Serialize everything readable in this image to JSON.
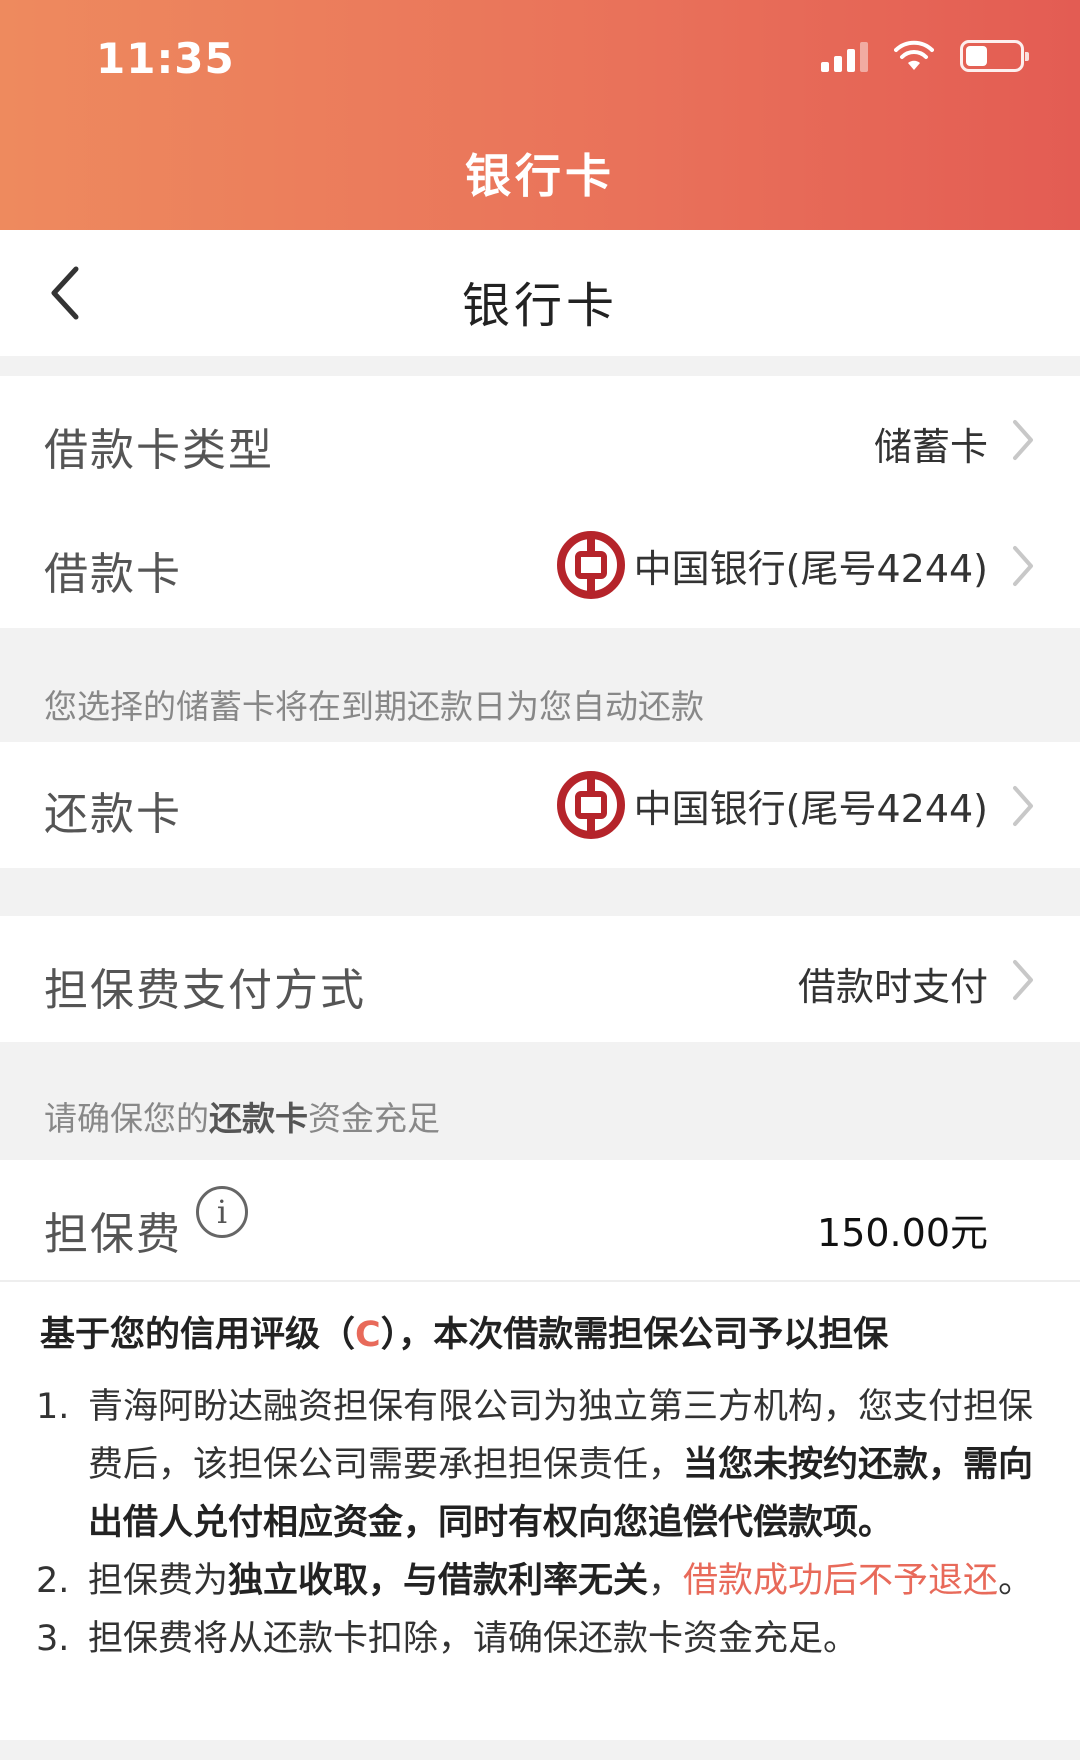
{
  "status_bar": {
    "time": "11:35"
  },
  "header": {
    "title": "银行卡"
  },
  "nav": {
    "title": "银行卡"
  },
  "rows": {
    "card_type": {
      "label": "借款卡类型",
      "value": "储蓄卡"
    },
    "loan_card": {
      "label": "借款卡",
      "value": "中国银行(尾号4244)"
    },
    "repay_card": {
      "label": "还款卡",
      "value": "中国银行(尾号4244)"
    },
    "fee_method": {
      "label": "担保费支付方式",
      "value": "借款时支付"
    },
    "fee": {
      "label": "担保费",
      "value": "150.00元"
    }
  },
  "notes": {
    "auto_repay": "您选择的储蓄卡将在到期还款日为您自动还款",
    "ensure_prefix": "请确保您的",
    "ensure_bold": "还款卡",
    "ensure_suffix": "资金充足"
  },
  "description": {
    "title_prefix": "基于您的信用评级（",
    "grade": "C",
    "title_suffix": "），本次借款需担保公司予以担保",
    "items": [
      {
        "num": "1.",
        "text": "青海阿盼达融资担保有限公司为独立第三方机构，您支付担保费后，该担保公司需要承担担保责任，",
        "bold": "当您未按约还款，需向出借人兑付相应资金，同时有权向您追偿代偿款项。"
      },
      {
        "num": "2.",
        "text": "担保费为",
        "bold": "独立收取，与借款利率无关",
        "sep": "，",
        "red": "借款成功后不予退还",
        "end": "。"
      },
      {
        "num": "3.",
        "text": "担保费将从还款卡扣除，请确保还款卡资金充足。"
      }
    ]
  },
  "icons": {
    "back": "chevron-left-icon",
    "chevron": "chevron-right-icon",
    "info": "info-icon",
    "bank": "bank-of-china-logo"
  },
  "colors": {
    "header_start": "#ee8a5e",
    "header_end": "#e35c53",
    "accent_red": "#e86a5a"
  }
}
